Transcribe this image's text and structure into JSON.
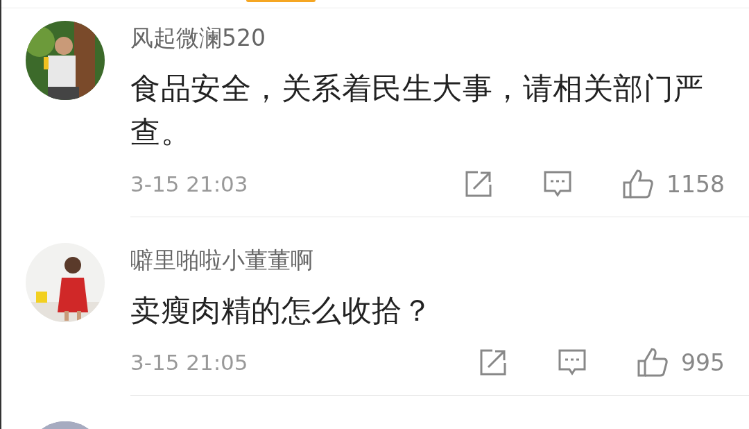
{
  "comments": [
    {
      "avatar": {
        "kind": "picture"
      },
      "name": "风起微澜520",
      "content": "食品安全，关系着民生大事，请相关部门严查。",
      "time": "3-15 21:03",
      "likes": "1158"
    },
    {
      "avatar": {
        "kind": "picture"
      },
      "name": "噼里啪啦小董董啊",
      "content": "卖瘦肉精的怎么收拾？",
      "time": "3-15 21:05",
      "likes": "995"
    },
    {
      "avatar": {
        "kind": "picture"
      }
    }
  ]
}
